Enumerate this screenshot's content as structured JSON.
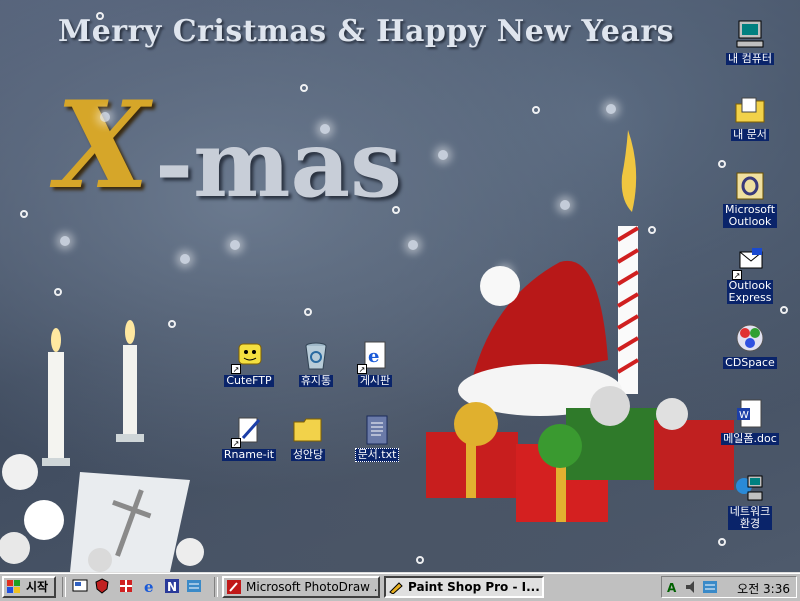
{
  "wallpaper": {
    "headline": "Merry Cristmas & Happy New Years",
    "title_x": "X",
    "title_rest": "-mas"
  },
  "desktop_icons": [
    {
      "label": "내 컴퓨터",
      "icon": "my-computer-icon"
    },
    {
      "label": "내 문서",
      "icon": "my-documents-icon"
    },
    {
      "label": "Microsoft\nOutlook",
      "icon": "outlook-icon"
    },
    {
      "label": "Outlook\nExpress",
      "icon": "outlook-express-icon"
    },
    {
      "label": "CDSpace",
      "icon": "cdspace-icon"
    },
    {
      "label": "메일폼.doc",
      "icon": "word-doc-icon"
    },
    {
      "label": "네트워크\n환경",
      "icon": "network-icon"
    },
    {
      "label": "CuteFTP",
      "icon": "cuteftp-icon"
    },
    {
      "label": "휴지통",
      "icon": "recycle-bin-icon"
    },
    {
      "label": "게시판",
      "icon": "ie-shortcut-icon"
    },
    {
      "label": "Rname-it",
      "icon": "rname-it-icon"
    },
    {
      "label": "성안당",
      "icon": "folder-icon"
    },
    {
      "label": "문서.txt",
      "icon": "text-file-icon"
    }
  ],
  "taskbar": {
    "start_label": "시작",
    "tasks": [
      {
        "label": "Microsoft PhotoDraw ...",
        "active": false
      },
      {
        "label": "Paint Shop Pro - I...",
        "active": true
      }
    ],
    "clock": "오전 3:36"
  },
  "colors": {
    "selection": "#0a246a",
    "taskbar": "#c0c0c0",
    "gold": "#d6a629"
  }
}
